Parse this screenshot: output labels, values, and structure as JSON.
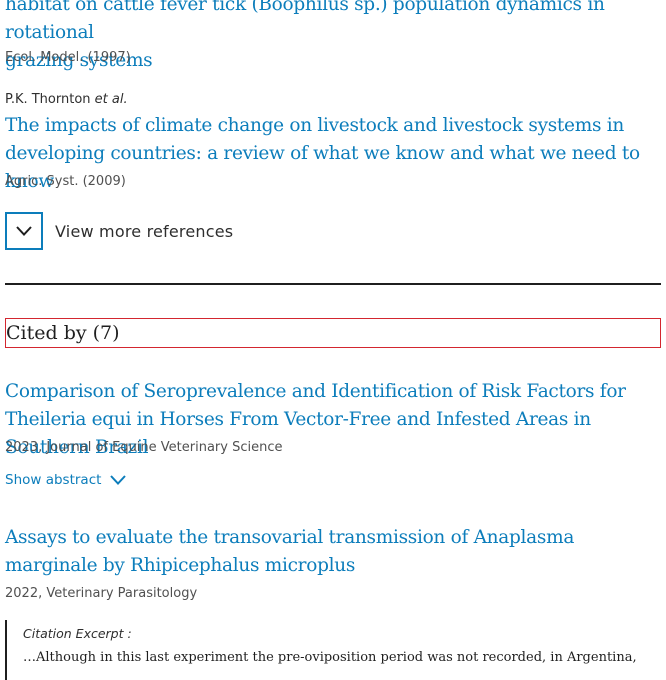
{
  "references": [
    {
      "title_line1": "habitat on cattle fever tick (Boophilus sp.) population dynamics in rotational",
      "title_line2": "grazing systems",
      "source": "Ecol. Model. (1997)"
    },
    {
      "authors": "P.K. Thornton",
      "authors_suffix": "et al.",
      "title": "The impacts of climate change on livestock and livestock systems in developing countries: a review of what we know and what we need to know",
      "source": "Agric. Syst. (2009)"
    }
  ],
  "view_more_label": "View more references",
  "cited_by": {
    "heading": "Cited by (7)",
    "items": [
      {
        "title": "Comparison of Seroprevalence and Identification of Risk Factors for Theileria equi in Horses From Vector-Free and Infested Areas in Southern Brazil",
        "meta": "2023, Journal of Equine Veterinary Science",
        "show_abstract_label": "Show abstract"
      },
      {
        "title": "Assays to evaluate the transovarial transmission of Anaplasma marginale by Rhipicephalus microplus",
        "meta": "2022, Veterinary Parasitology",
        "excerpt_label": "Citation Excerpt :",
        "excerpt_text": "…Although in this last experiment the pre-oviposition period was not recorded, in Argentina,"
      }
    ]
  },
  "colors": {
    "link": "#0c7dbb",
    "highlight_border": "#d3262f",
    "text": "#1f1f1f"
  },
  "icons": {
    "expand": "chevron-down-icon",
    "abstract": "chevron-down-icon"
  }
}
